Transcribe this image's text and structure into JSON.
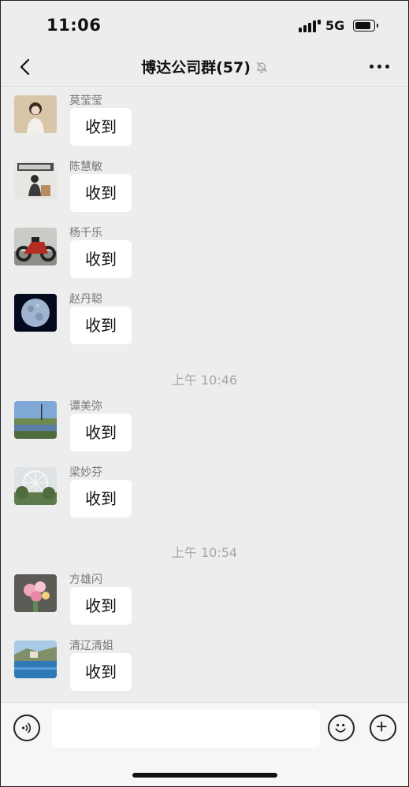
{
  "status": {
    "time": "11:06",
    "network": "5G"
  },
  "header": {
    "title": "博达公司群(57)"
  },
  "icons": {
    "back": "chevron-left-icon",
    "mute": "bell-slash-icon",
    "more": "more-horizontal-icon",
    "voice": "voice-icon",
    "emoji": "emoji-icon",
    "plus": "plus-icon"
  },
  "messages": [
    {
      "sender": "莫莹莹",
      "text": "收到"
    },
    {
      "sender": "陈慧敏",
      "text": "收到"
    },
    {
      "sender": "杨千乐",
      "text": "收到"
    },
    {
      "sender": "赵丹聪",
      "text": "收到"
    },
    {
      "sender": "谭美弥",
      "text": "收到"
    },
    {
      "sender": "梁妙芬",
      "text": "收到"
    },
    {
      "sender": "方雄闪",
      "text": "收到"
    },
    {
      "sender": "清辽清姐",
      "text": "收到"
    }
  ],
  "timestamps": [
    "上午 10:46",
    "上午 10:54"
  ],
  "input": {
    "value": ""
  }
}
